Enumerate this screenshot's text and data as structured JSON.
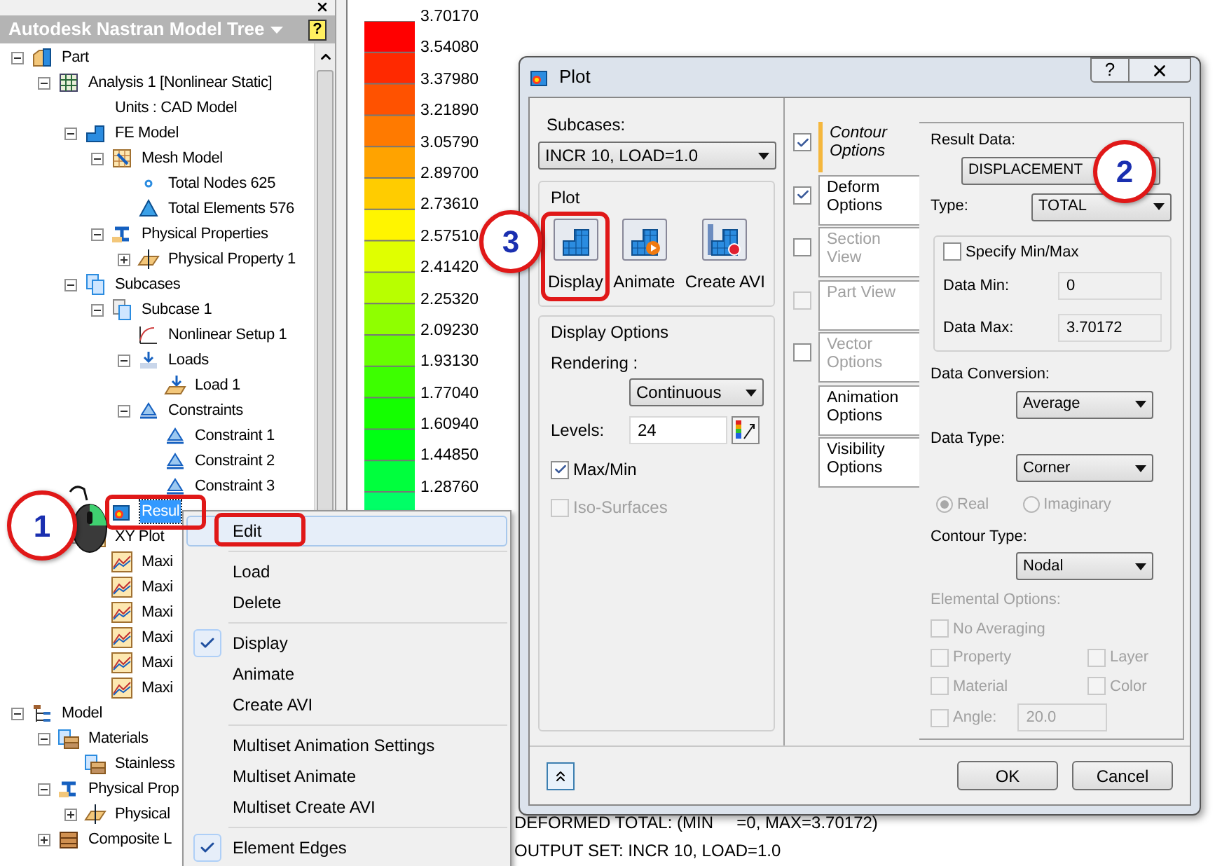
{
  "tree_panel": {
    "title": "Autodesk Nastran Model Tree",
    "help": "?",
    "nodes": [
      {
        "label": "Part",
        "kind": "part",
        "selected": false,
        "expanded": true,
        "children": [
          {
            "label": "Analysis 1 [Nonlinear Static]",
            "kind": "analysis",
            "selected": false,
            "expanded": true,
            "children": [
              {
                "label": "Units : CAD Model",
                "kind": "text",
                "selected": false
              },
              {
                "label": "FE Model",
                "kind": "fe",
                "selected": false,
                "expanded": true,
                "children": [
                  {
                    "label": "Mesh Model",
                    "kind": "mesh",
                    "selected": false,
                    "expanded": true,
                    "children": [
                      {
                        "label": "Total Nodes 625",
                        "kind": "node",
                        "selected": false
                      },
                      {
                        "label": "Total Elements 576",
                        "kind": "element",
                        "selected": false
                      }
                    ]
                  },
                  {
                    "label": "Physical Properties",
                    "kind": "properties",
                    "selected": false,
                    "expanded": true,
                    "children": [
                      {
                        "label": "Physical Property 1",
                        "kind": "property",
                        "selected": false,
                        "expanded": false
                      }
                    ]
                  }
                ]
              },
              {
                "label": "Subcases",
                "kind": "subcases",
                "selected": false,
                "expanded": true,
                "children": [
                  {
                    "label": "Subcase 1",
                    "kind": "subcase",
                    "selected": false,
                    "expanded": true,
                    "children": [
                      {
                        "label": "Nonlinear Setup 1",
                        "kind": "setup",
                        "selected": false
                      },
                      {
                        "label": "Loads",
                        "kind": "loads",
                        "selected": false,
                        "expanded": true,
                        "children": [
                          {
                            "label": "Load 1",
                            "kind": "load",
                            "selected": false
                          }
                        ]
                      },
                      {
                        "label": "Constraints",
                        "kind": "constraints",
                        "selected": false,
                        "expanded": true,
                        "children": [
                          {
                            "label": "Constraint 1",
                            "kind": "constraint",
                            "selected": false
                          },
                          {
                            "label": "Constraint 2",
                            "kind": "constraint",
                            "selected": false
                          },
                          {
                            "label": "Constraint 3",
                            "kind": "constraint",
                            "selected": false
                          }
                        ]
                      }
                    ]
                  },
                  {
                    "label": "Resul",
                    "kind": "results",
                    "selected": true
                  }
                ]
              },
              {
                "label": "XY Plot",
                "kind": "xyplot",
                "selected": false,
                "expanded": true,
                "children": [
                  {
                    "label": "Maxi",
                    "kind": "plot",
                    "selected": false
                  },
                  {
                    "label": "Maxi",
                    "kind": "plot",
                    "selected": false
                  },
                  {
                    "label": "Maxi",
                    "kind": "plot",
                    "selected": false
                  },
                  {
                    "label": "Maxi",
                    "kind": "plot",
                    "selected": false
                  },
                  {
                    "label": "Maxi",
                    "kind": "plot",
                    "selected": false
                  },
                  {
                    "label": "Maxi",
                    "kind": "plot",
                    "selected": false
                  }
                ]
              }
            ]
          }
        ]
      },
      {
        "label": "Model",
        "kind": "model",
        "selected": false,
        "expanded": true,
        "children": [
          {
            "label": "Materials",
            "kind": "materials",
            "selected": false,
            "expanded": true,
            "children": [
              {
                "label": "Stainless",
                "kind": "material",
                "selected": false
              }
            ]
          },
          {
            "label": "Physical Prop",
            "kind": "properties",
            "selected": false,
            "expanded": true,
            "children": [
              {
                "label": "Physical",
                "kind": "property",
                "selected": false,
                "expanded": false
              }
            ]
          },
          {
            "label": "Composite L",
            "kind": "composite",
            "selected": false,
            "expanded": false
          }
        ]
      }
    ]
  },
  "legend": {
    "values": [
      "3.70170",
      "3.54080",
      "3.37980",
      "3.21890",
      "3.05790",
      "2.89700",
      "2.73610",
      "2.57510",
      "2.41420",
      "2.25320",
      "2.09230",
      "1.93130",
      "1.77040",
      "1.60940",
      "1.44850",
      "1.28760"
    ]
  },
  "viewport_text": [
    "DEFORMED TOTAL: (MIN     =0, MAX=3.70172)",
    "OUTPUT SET: INCR 10, LOAD=1.0"
  ],
  "plot_dialog": {
    "title": "Plot",
    "help": "?",
    "subcases": {
      "label": "Subcases:",
      "value": "INCR 10, LOAD=1.0"
    },
    "plot_group": {
      "title": "Plot",
      "buttons": [
        {
          "label": "Display",
          "kind": "display",
          "selected": true
        },
        {
          "label": "Animate",
          "kind": "animate",
          "selected": false
        },
        {
          "label": "Create AVI",
          "kind": "avi",
          "selected": false
        }
      ]
    },
    "display_options": {
      "title": "Display Options",
      "rendering_label": "Rendering :",
      "rendering": "Continuous",
      "levels_label": "Levels:",
      "levels": "24",
      "checkboxes": [
        {
          "label": "Max/Min",
          "checked": true,
          "disabled": false
        },
        {
          "label": "Iso-Surfaces",
          "checked": false,
          "disabled": true
        }
      ]
    },
    "tabs": [
      {
        "label": "Contour Options",
        "selected": true,
        "disabled": false,
        "checkbox": {
          "checked": true,
          "disabled": false
        }
      },
      {
        "label": "Deform Options",
        "selected": false,
        "disabled": false,
        "checkbox": {
          "checked": true,
          "disabled": false
        }
      },
      {
        "label": "Section View",
        "selected": false,
        "disabled": true,
        "checkbox": {
          "checked": false,
          "disabled": false
        }
      },
      {
        "label": "Part View",
        "selected": false,
        "disabled": true,
        "checkbox": {
          "checked": false,
          "disabled": true
        }
      },
      {
        "label": "Vector Options",
        "selected": false,
        "disabled": true,
        "checkbox": {
          "checked": false,
          "disabled": false
        }
      },
      {
        "label": "Animation Options",
        "selected": false,
        "disabled": false
      },
      {
        "label": "Visibility Options",
        "selected": false,
        "disabled": false
      }
    ],
    "contour_options": {
      "result_data_label": "Result Data:",
      "result_data": "DISPLACEMENT",
      "type_label": "Type:",
      "type": "TOTAL",
      "specify": {
        "label": "Specify Min/Max",
        "checked": false
      },
      "data_min_label": "Data Min:",
      "data_min": "0",
      "data_max_label": "Data Max:",
      "data_max": "3.70172",
      "conversion_label": "Data Conversion:",
      "conversion": "Average",
      "data_type_label": "Data Type:",
      "data_type": "Corner",
      "radios": [
        {
          "label": "Real",
          "selected": true,
          "disabled": true
        },
        {
          "label": "Imaginary",
          "selected": false,
          "disabled": true
        }
      ],
      "contour_type_label": "Contour Type:",
      "contour_type": "Nodal",
      "elemental_label": "Elemental Options:",
      "elemental_disabled": true,
      "elemental": [
        {
          "label": "No Averaging",
          "checked": false
        },
        {
          "label": "Property",
          "checked": false
        },
        {
          "label": "Layer",
          "checked": false
        },
        {
          "label": "Material",
          "checked": false
        },
        {
          "label": "Color",
          "checked": false
        },
        {
          "label": "Angle:",
          "checked": false
        }
      ],
      "angle": "20.0"
    },
    "buttons": [
      "OK",
      "Cancel"
    ]
  },
  "context_menu": {
    "items": [
      {
        "kind": "item",
        "label": "Edit",
        "checked": false,
        "selected": true
      },
      {
        "kind": "separator"
      },
      {
        "kind": "item",
        "label": "Load",
        "checked": false,
        "selected": false
      },
      {
        "kind": "item",
        "label": "Delete",
        "checked": false,
        "selected": false
      },
      {
        "kind": "separator"
      },
      {
        "kind": "item",
        "label": "Display",
        "checked": true,
        "selected": false
      },
      {
        "kind": "item",
        "label": "Animate",
        "checked": false,
        "selected": false
      },
      {
        "kind": "item",
        "label": "Create AVI",
        "checked": false,
        "selected": false
      },
      {
        "kind": "separator"
      },
      {
        "kind": "item",
        "label": "Multiset Animation Settings",
        "checked": false,
        "selected": false
      },
      {
        "kind": "item",
        "label": "Multiset Animate",
        "checked": false,
        "selected": false
      },
      {
        "kind": "item",
        "label": "Multiset Create AVI",
        "checked": false,
        "selected": false
      },
      {
        "kind": "separator"
      },
      {
        "kind": "item",
        "label": "Element Edges",
        "checked": true,
        "selected": false
      }
    ]
  },
  "callouts": [
    "1",
    "2",
    "3"
  ]
}
